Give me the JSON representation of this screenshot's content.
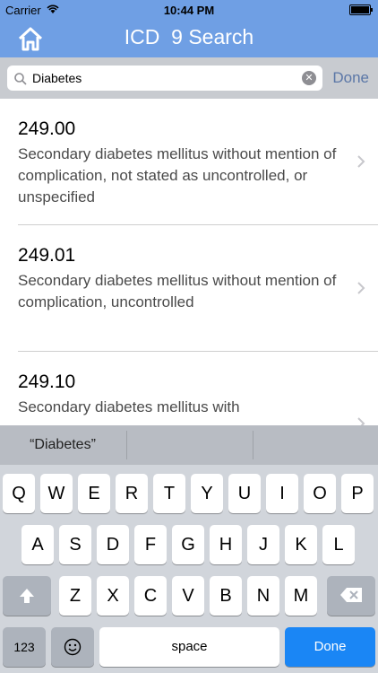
{
  "status_bar": {
    "carrier": "Carrier",
    "time": "10:44 PM",
    "battery_level": 1.0
  },
  "nav_bar": {
    "title": "ICD  9 Search",
    "home_icon": "home-icon"
  },
  "search": {
    "value": "Diabetes",
    "done_label": "Done"
  },
  "results": [
    {
      "code": "249.00",
      "description": "Secondary diabetes mellitus without mention of complication, not stated as uncontrolled, or unspecified"
    },
    {
      "code": "249.01",
      "description": "Secondary diabetes mellitus without mention of complication, uncontrolled"
    },
    {
      "code": "249.10",
      "description": "Secondary diabetes mellitus with"
    }
  ],
  "suggestions": [
    "“Diabetes”",
    "",
    ""
  ],
  "keyboard": {
    "row1": [
      "Q",
      "W",
      "E",
      "R",
      "T",
      "Y",
      "U",
      "I",
      "O",
      "P"
    ],
    "row2": [
      "A",
      "S",
      "D",
      "F",
      "G",
      "H",
      "J",
      "K",
      "L"
    ],
    "row3": [
      "Z",
      "X",
      "C",
      "V",
      "B",
      "N",
      "M"
    ],
    "numbers_label": "123",
    "space_label": "space",
    "done_label": "Done"
  },
  "colors": {
    "nav_blue": "#6f9fe4",
    "done_blue": "#1a86f5",
    "link_done": "#5b77a7"
  }
}
